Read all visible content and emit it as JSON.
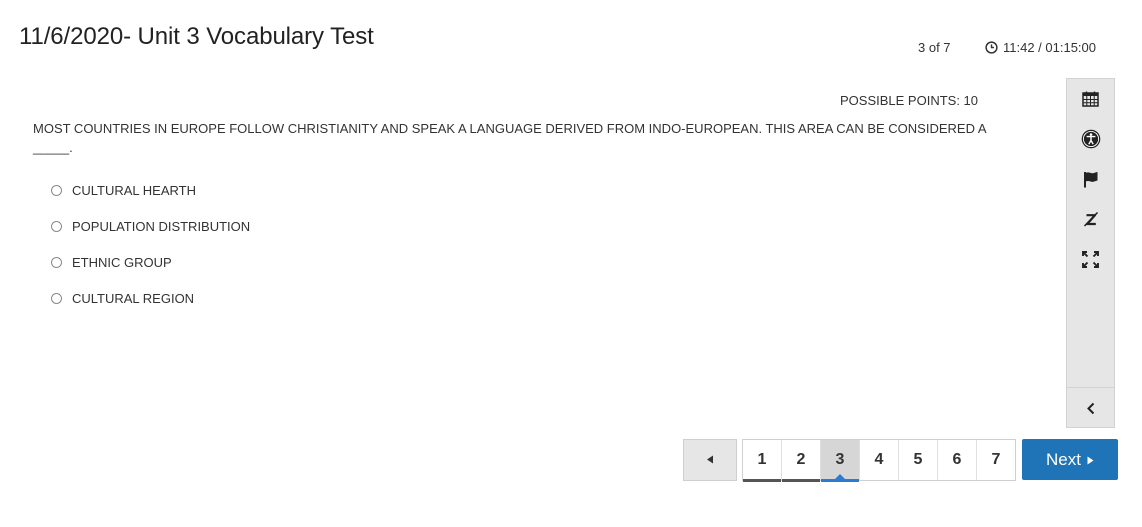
{
  "header": {
    "title": "11/6/2020- Unit 3 Vocabulary Test",
    "progress": "3 of 7",
    "timer": "11:42 / 01:15:00"
  },
  "question": {
    "points": "POSSIBLE POINTS: 10",
    "text": "MOST COUNTRIES IN EUROPE FOLLOW CHRISTIANITY AND SPEAK A LANGUAGE DERIVED FROM INDO-EUROPEAN. THIS AREA CAN BE CONSIDERED A _____.",
    "options": [
      "CULTURAL HEARTH",
      "POPULATION DISTRIBUTION",
      "ETHNIC GROUP",
      "CULTURAL REGION"
    ]
  },
  "toolbar": {
    "icons": [
      "calendar-icon",
      "accessibility-icon",
      "flag-icon",
      "strikethrough-icon",
      "fullscreen-icon",
      "collapse-icon"
    ]
  },
  "pagination": {
    "pages": [
      "1",
      "2",
      "3",
      "4",
      "5",
      "6",
      "7"
    ],
    "current": 3,
    "next_label": "Next"
  },
  "colors": {
    "accent": "#1f74b8",
    "current_page_bg": "#d6d6d6",
    "toolbar_bg": "#e6e6e6"
  }
}
